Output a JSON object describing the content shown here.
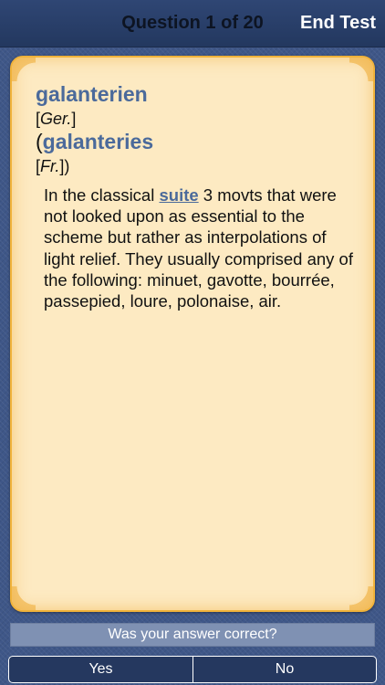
{
  "navbar": {
    "title": "Question 1 of 20",
    "end_test_label": "End Test"
  },
  "card": {
    "term": "galanterien",
    "lang1_open": "[",
    "lang1": "Ger.",
    "lang1_close": "]",
    "alt_open": "(",
    "alt_term": "galanteries",
    "lang2_open": "[",
    "lang2": "Fr.",
    "lang2_close": "])",
    "definition_before": "In the classical ",
    "definition_link": "suite",
    "definition_after": " 3 movts that were not looked upon as essential to the scheme but rather as interpolations of light relief. They usually comprised any of the following: minuet, gavotte, bourrée, passepied, loure, polonaise, air."
  },
  "prompt": {
    "question": "Was your answer correct?",
    "yes_label": "Yes",
    "no_label": "No"
  },
  "colors": {
    "background": "#3f5788",
    "card": "#fdeac2",
    "card_border": "#f0b23a",
    "term": "#4b6a9b"
  }
}
